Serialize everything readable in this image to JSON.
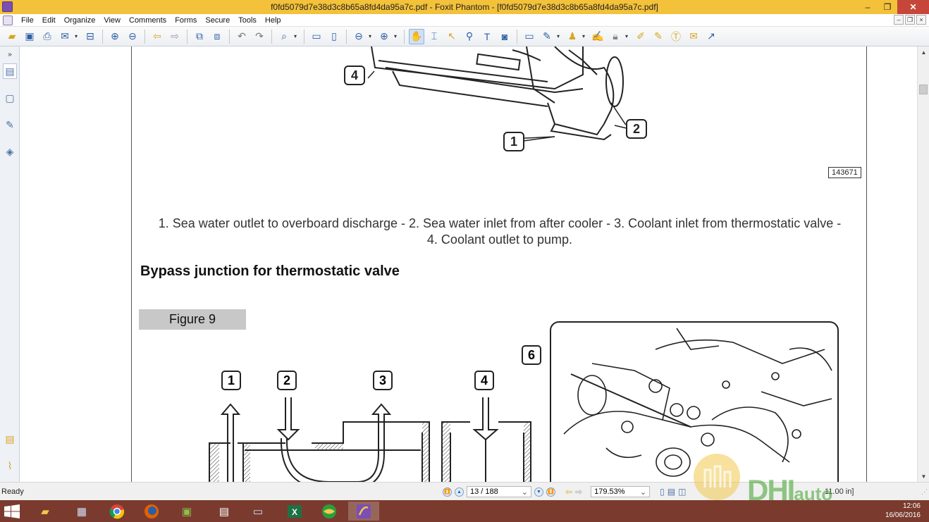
{
  "window": {
    "title": "f0fd5079d7e38d3c8b65a8fd4da95a7c.pdf - Foxit Phantom - [f0fd5079d7e38d3c8b65a8fd4da95a7c.pdf]",
    "minimize": "–",
    "maximize": "❐",
    "close": "✕"
  },
  "menubar": {
    "items": [
      "File",
      "Edit",
      "Organize",
      "View",
      "Comments",
      "Forms",
      "Secure",
      "Tools",
      "Help"
    ]
  },
  "document": {
    "figure_code": "143671",
    "callouts_top": [
      "4",
      "2",
      "1"
    ],
    "caption_line1": "1. Sea water outlet to overboard discharge - 2. Sea water inlet from after cooler - 3. Coolant inlet from thermostatic valve -",
    "caption_line2": "4. Coolant outlet to pump.",
    "heading": "Bypass junction for thermostatic valve",
    "figure_label": "Figure 9",
    "callouts_fig9": [
      "1",
      "2",
      "3",
      "4",
      "6"
    ]
  },
  "statusbar": {
    "status": "Ready",
    "page": "13 / 188",
    "zoom": "179.53%",
    "page_size": "11.00 in]"
  },
  "taskbar": {
    "time": "12:06",
    "date": "16/06/2016"
  },
  "watermark": {
    "brand_left": "DHI",
    "brand_right": "auto"
  }
}
